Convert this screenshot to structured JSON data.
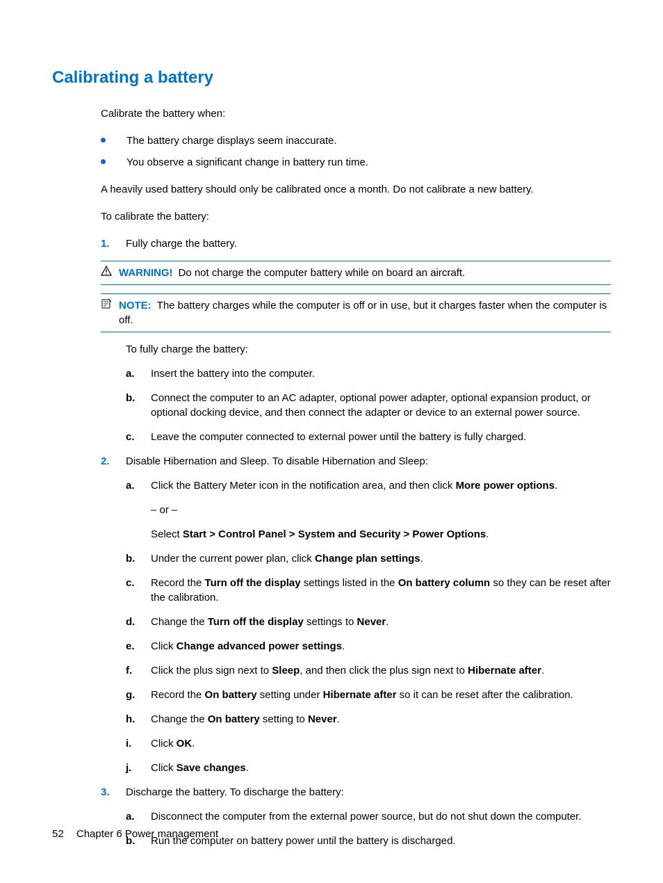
{
  "title": "Calibrating a battery",
  "intro": "Calibrate the battery when:",
  "bullets": [
    "The battery charge displays seem inaccurate.",
    "You observe a significant change in battery run time."
  ],
  "para2": "A heavily used battery should only be calibrated once a month. Do not calibrate a new battery.",
  "para3": "To calibrate the battery:",
  "steps": {
    "s1": {
      "num": "1.",
      "text": "Fully charge the battery.",
      "warning_label": "WARNING!",
      "warning_text": "Do not charge the computer battery while on board an aircraft.",
      "note_label": "NOTE:",
      "note_text": "The battery charges while the computer is off or in use, but it charges faster when the computer is off.",
      "subintro": "To fully charge the battery:",
      "a": {
        "lbl": "a.",
        "text": "Insert the battery into the computer."
      },
      "b": {
        "lbl": "b.",
        "text": "Connect the computer to an AC adapter, optional power adapter, optional expansion product, or optional docking device, and then connect the adapter or device to an external power source."
      },
      "c": {
        "lbl": "c.",
        "text": "Leave the computer connected to external power until the battery is fully charged."
      }
    },
    "s2": {
      "num": "2.",
      "text": "Disable Hibernation and Sleep. To disable Hibernation and Sleep:",
      "a": {
        "lbl": "a.",
        "pre": "Click the Battery Meter icon in the notification area, and then click ",
        "bold1": "More power options",
        "post1": ".",
        "or": "– or –",
        "select_pre": "Select ",
        "select_bold": "Start > Control Panel > System and Security > Power Options",
        "select_post": "."
      },
      "b": {
        "lbl": "b.",
        "pre": "Under the current power plan, click ",
        "bold": "Change plan settings",
        "post": "."
      },
      "c": {
        "lbl": "c.",
        "p1": "Record the ",
        "b1": "Turn off the display",
        "p2": " settings listed in the ",
        "b2": "On battery column",
        "p3": " so they can be reset after the calibration."
      },
      "d": {
        "lbl": "d.",
        "p1": "Change the ",
        "b1": "Turn off the display",
        "p2": " settings to ",
        "b2": "Never",
        "p3": "."
      },
      "e": {
        "lbl": "e.",
        "p1": "Click ",
        "b1": "Change advanced power settings",
        "p2": "."
      },
      "f": {
        "lbl": "f.",
        "p1": "Click the plus sign next to ",
        "b1": "Sleep",
        "p2": ", and then click the plus sign next to ",
        "b2": "Hibernate after",
        "p3": "."
      },
      "g": {
        "lbl": "g.",
        "p1": "Record the ",
        "b1": "On battery",
        "p2": " setting under ",
        "b2": "Hibernate after",
        "p3": " so it can be reset after the calibration."
      },
      "h": {
        "lbl": "h.",
        "p1": "Change the ",
        "b1": "On battery",
        "p2": " setting to ",
        "b2": "Never",
        "p3": "."
      },
      "i": {
        "lbl": "i.",
        "p1": "Click ",
        "b1": "OK",
        "p2": "."
      },
      "j": {
        "lbl": "j.",
        "p1": "Click ",
        "b1": "Save changes",
        "p2": "."
      }
    },
    "s3": {
      "num": "3.",
      "text": "Discharge the battery. To discharge the battery:",
      "a": {
        "lbl": "a.",
        "text": "Disconnect the computer from the external power source, but do not shut down the computer."
      },
      "b": {
        "lbl": "b.",
        "text": "Run the computer on battery power until the battery is discharged."
      }
    }
  },
  "footer": {
    "page": "52",
    "chapter": "Chapter 6   Power management"
  }
}
